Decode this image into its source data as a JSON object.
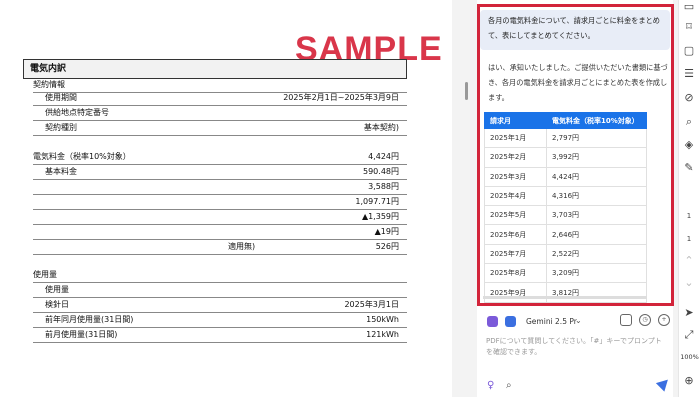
{
  "document": {
    "watermark": "SAMPLE",
    "title": "電気内訳",
    "rows": [
      {
        "label": "契約情報",
        "value": "",
        "indent": false
      },
      {
        "label": "使用期間",
        "value": "2025年2月1日~2025年3月9日",
        "indent": true
      },
      {
        "label": "供給地点特定番号",
        "value": "",
        "indent": true
      },
      {
        "label": "契約種別",
        "value": "基本契約)",
        "indent": true
      },
      {
        "label": "",
        "value": "",
        "indent": false,
        "blank": true
      },
      {
        "label": "電気料金（税率10%対象）",
        "value": "4,424円",
        "indent": false
      },
      {
        "label": "基本料金",
        "value": "590.48円",
        "indent": true
      },
      {
        "label": "",
        "value": "3,588円",
        "indent": true
      },
      {
        "label": "",
        "value": "1,097.71円",
        "indent": true
      },
      {
        "label": "",
        "value": "▲1,359円",
        "indent": true
      },
      {
        "label": "",
        "value": "▲19円",
        "indent": true
      },
      {
        "label": "",
        "mid": "適用無)",
        "value": "526円",
        "indent": true
      },
      {
        "label": "",
        "value": "",
        "indent": false,
        "blank": true
      },
      {
        "label": "使用量",
        "value": "",
        "indent": false
      },
      {
        "label": "使用量",
        "value": "",
        "indent": true
      },
      {
        "label": "検針日",
        "value": "2025年3月1日",
        "indent": true
      },
      {
        "label": "前年同月使用量(31日間)",
        "value": "150kWh",
        "indent": true
      },
      {
        "label": "前月使用量(31日間)",
        "value": "121kWh",
        "indent": true
      }
    ]
  },
  "chat": {
    "user_message": "各月の電気料金について、請求月ごとに料金をまとめて、表にしてまとめてください。",
    "reply": "はい、承知いたしました。ご提供いただいた書類に基づき、各月の電気料金を請求月ごとにまとめた表を作成します。",
    "table": {
      "headers": [
        "請求月",
        "電気料金（税率10%対象）"
      ],
      "rows": [
        [
          "2025年1月",
          "2,797円"
        ],
        [
          "2025年2月",
          "3,992円"
        ],
        [
          "2025年3月",
          "4,424円"
        ],
        [
          "2025年4月",
          "4,316円"
        ],
        [
          "2025年5月",
          "3,703円"
        ],
        [
          "2025年6月",
          "2,646円"
        ],
        [
          "2025年7月",
          "2,522円"
        ],
        [
          "2025年8月",
          "3,209円"
        ],
        [
          "2025年9月",
          "3,812円"
        ]
      ]
    },
    "model_name": "Gemini 2.5 Pr",
    "input_placeholder": "PDFについて質問してください。「#」キーでプロンプトを確認できます。"
  },
  "rail": {
    "page_current": "1",
    "page_total": "1",
    "zoom": "100%"
  },
  "colors": {
    "watermark": "#d9364a",
    "frame": "#d2243a",
    "table_header": "#1a73e8",
    "user_bubble": "#e8edf7"
  }
}
